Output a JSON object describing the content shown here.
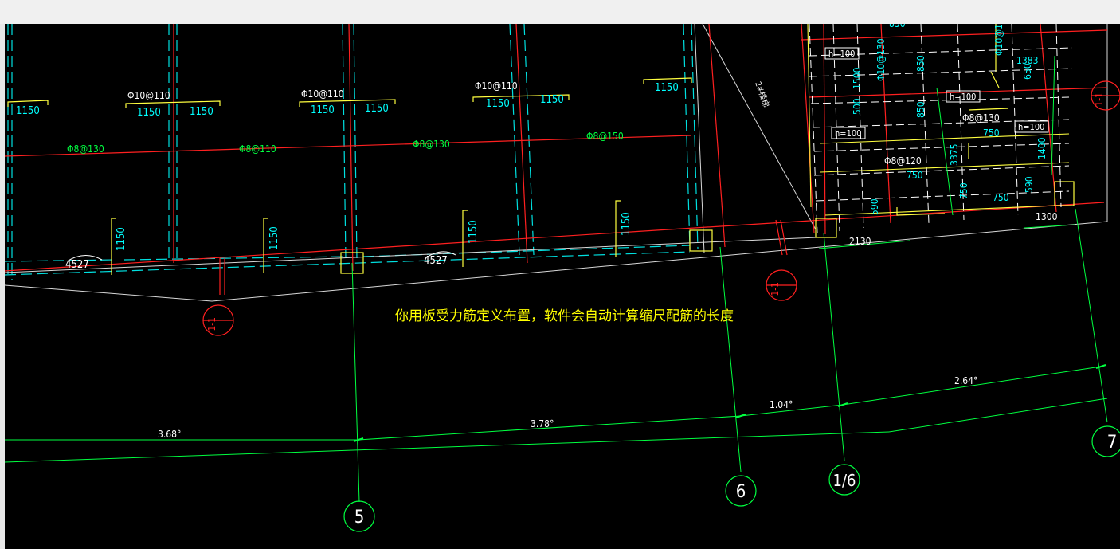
{
  "annotation": "你用板受力筋定义布置，软件会自动计算缩尺配筋的长度",
  "top_bar_labels": [
    "1150",
    "1150",
    "1150",
    "1150",
    "1150",
    "1150",
    "1150"
  ],
  "top_rebar_labels": [
    "Φ10@110",
    "Φ10@110",
    "Φ10@110"
  ],
  "bottom_rebar_labels": [
    "Φ8@130",
    "Φ8@110",
    "Φ8@130",
    "Φ8@150"
  ],
  "vertical_bar_labels": [
    "1150",
    "1150",
    "1150",
    "1150"
  ],
  "radius_labels": [
    "4527",
    "4527"
  ],
  "section_marks": [
    "1-1",
    "1-1",
    "1-1"
  ],
  "right_detail": {
    "h_labels": [
      "h=100",
      "h=100",
      "h=100",
      "h=100"
    ],
    "values": [
      "850",
      "1383",
      "850",
      "1500",
      "500",
      "850",
      "750",
      "Φ8@130",
      "3375",
      "1400",
      "Φ8@120",
      "750",
      "750",
      "750",
      "590",
      "650",
      "590"
    ],
    "dim_2130": "2130",
    "dim_1300": "1300",
    "diag_label": "2#楼梯"
  },
  "angle_dims": [
    "3.68°",
    "3.78°",
    "1.04°",
    "2.64°"
  ],
  "axis_labels": [
    "5",
    "6",
    "1/6",
    "7"
  ],
  "colors": {
    "yellow": "#ffff00",
    "cyan": "#00ffff",
    "red": "#ff0000",
    "green": "#00ff00",
    "white": "#ffffff"
  }
}
